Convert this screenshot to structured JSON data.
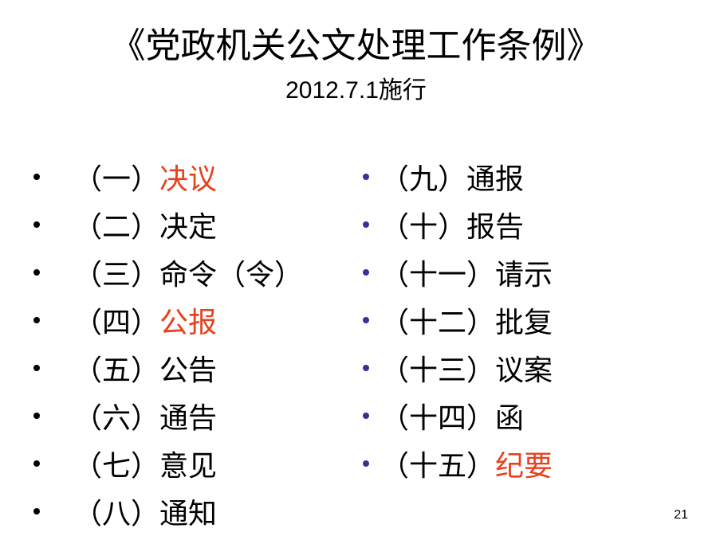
{
  "slide": {
    "title": "《党政机关公文处理工作条例》",
    "subtitle": "2012.7.1施行",
    "page_number": "21"
  },
  "colors": {
    "highlight": "#e8401c",
    "normal": "#000000",
    "right_bullet": "#333399"
  },
  "left_items": [
    {
      "num": "（一）",
      "name": "决议",
      "highlight": true
    },
    {
      "num": "（二）",
      "name": "决定",
      "highlight": false
    },
    {
      "num": "（三）",
      "name": "命令（令）",
      "highlight": false
    },
    {
      "num": "（四）",
      "name": "公报",
      "highlight": true
    },
    {
      "num": "（五）",
      "name": "公告",
      "highlight": false
    },
    {
      "num": "（六）",
      "name": "通告",
      "highlight": false
    },
    {
      "num": "（七）",
      "name": "意见",
      "highlight": false
    },
    {
      "num": "（八）",
      "name": "通知",
      "highlight": false
    }
  ],
  "right_items": [
    {
      "num": "（九）",
      "name": "通报",
      "highlight": false
    },
    {
      "num": "（十）",
      "name": "报告",
      "highlight": false
    },
    {
      "num": "（十一）",
      "name": "请示",
      "highlight": false
    },
    {
      "num": "（十二）",
      "name": "批复",
      "highlight": false
    },
    {
      "num": "（十三）",
      "name": "议案",
      "highlight": false
    },
    {
      "num": "（十四）",
      "name": "函",
      "highlight": false
    },
    {
      "num": "（十五）",
      "name": "纪要",
      "highlight": true
    }
  ]
}
